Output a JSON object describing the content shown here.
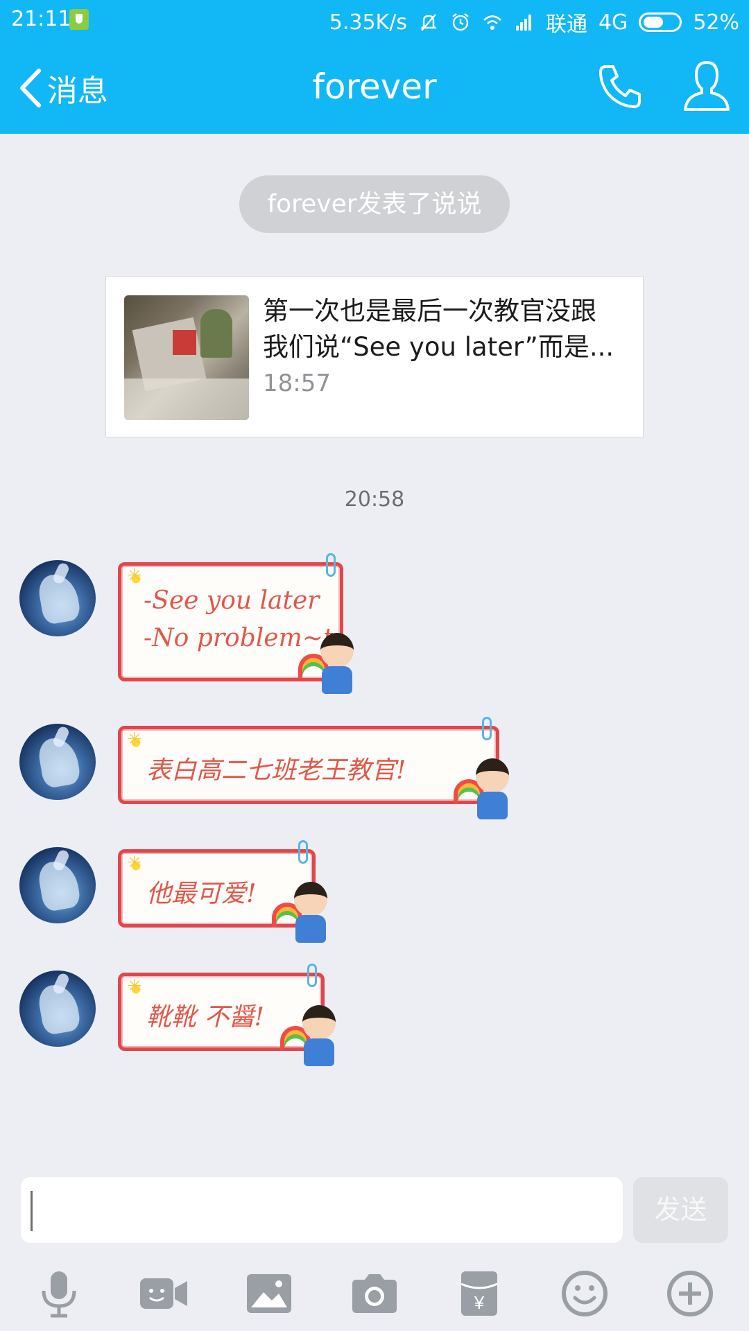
{
  "status_bar": {
    "time": "21:11",
    "network_speed": "5.35K/s",
    "carrier": "联通",
    "network_type": "4G",
    "battery": "52%",
    "battery_level_percent": 52
  },
  "nav": {
    "back_label": "消息",
    "title": "forever",
    "color": "#12b7f5"
  },
  "system_notice": "forever发表了说说",
  "share_card": {
    "line1": "第一次也是最后一次教官没跟",
    "line2": "我们说“See you later”而是...",
    "time": "18:57"
  },
  "timestamp": "20:58",
  "messages": [
    {
      "line1": "-See you later",
      "line2": "-No problem~t"
    },
    {
      "line1": "表白高二七班老王教官!"
    },
    {
      "line1": "他最可爱!"
    },
    {
      "line1": "靴靴 不醤!"
    }
  ],
  "input": {
    "value": "",
    "send_label": "发送"
  },
  "toolbar_icons": [
    "microphone-icon",
    "video-call-icon",
    "image-icon",
    "camera-icon",
    "red-packet-icon",
    "emoji-icon",
    "plus-icon"
  ]
}
